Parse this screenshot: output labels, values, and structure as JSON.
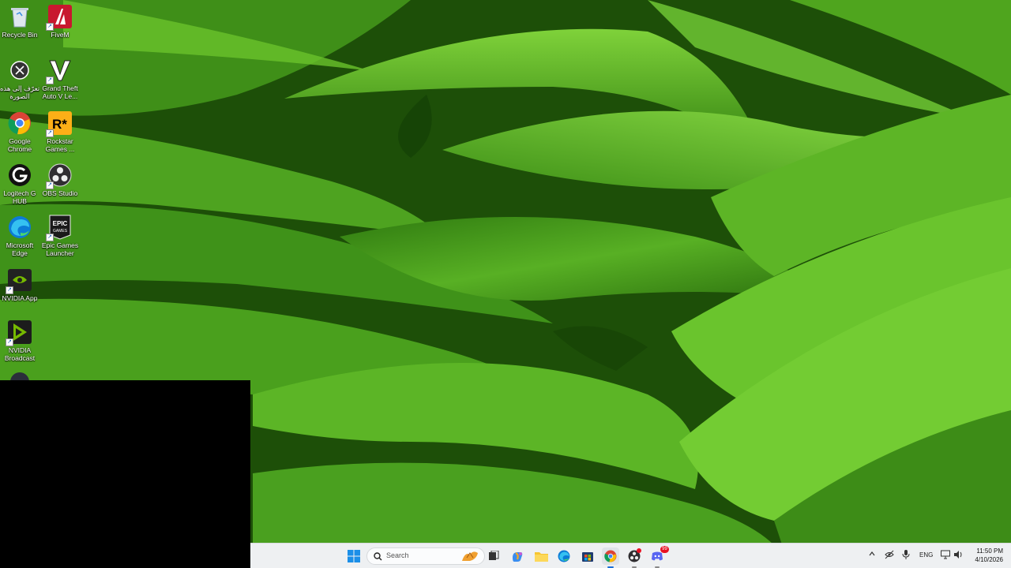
{
  "desktop": {
    "icons": [
      {
        "label": "Recycle Bin",
        "icon": "recycle-bin-icon"
      },
      {
        "label": "FiveM",
        "icon": "fivem-icon"
      },
      {
        "label": "تعرّف إلى هذه الصورة",
        "icon": "learn-about-picture-icon"
      },
      {
        "label": "Grand Theft Auto V Le...",
        "icon": "gta-v-icon"
      },
      {
        "label": "Google Chrome",
        "icon": "chrome-icon"
      },
      {
        "label": "Rockstar Games ...",
        "icon": "rockstar-icon"
      },
      {
        "label": "Logitech G HUB",
        "icon": "logitech-ghub-icon"
      },
      {
        "label": "OBS Studio",
        "icon": "obs-icon"
      },
      {
        "label": "Microsoft Edge",
        "icon": "edge-icon"
      },
      {
        "label": "Epic Games Launcher",
        "icon": "epic-games-icon"
      },
      {
        "label": "NVIDIA App",
        "icon": "nvidia-app-icon"
      },
      {
        "label": "NVIDIA Broadcast",
        "icon": "nvidia-broadcast-icon"
      }
    ],
    "epic_icon_text": "EPIC GAMES",
    "rockstar_icon_text": "R*"
  },
  "taskbar": {
    "search_placeholder": "Search",
    "apps": [
      "start-icon",
      "task-view-icon",
      "copilot-icon",
      "file-explorer-icon",
      "edge-icon",
      "store-icon",
      "chrome-icon",
      "obs-icon",
      "discord-icon"
    ],
    "discord_badge": "99",
    "tray": {
      "language": "ENG",
      "time": "11:50 PM",
      "date": "4/10/2026"
    }
  },
  "colors": {
    "taskbar_bg": "#eef0f2",
    "leaf_dark": "#1f5a0a",
    "leaf_light": "#6cc02a"
  }
}
